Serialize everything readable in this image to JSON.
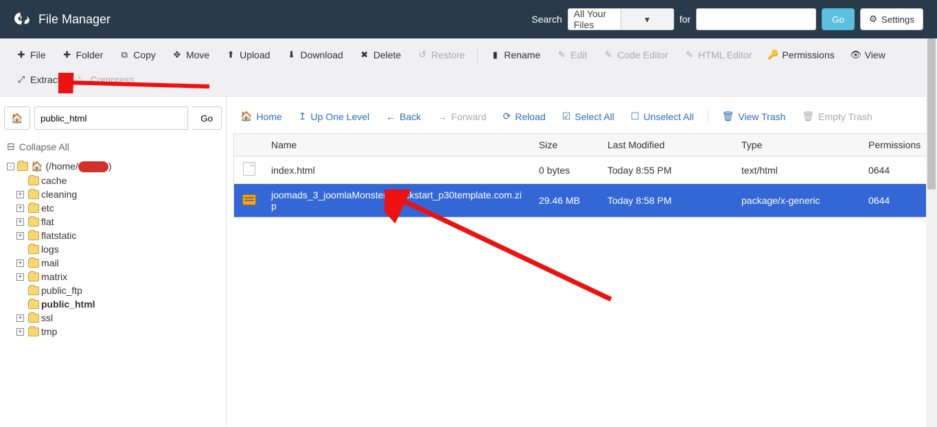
{
  "header": {
    "title": "File Manager",
    "search_label": "Search",
    "search_scope": "All Your Files",
    "for_label": "for",
    "search_value": "",
    "go_label": "Go",
    "settings_label": "Settings"
  },
  "toolbar": {
    "file": "File",
    "folder": "Folder",
    "copy": "Copy",
    "move": "Move",
    "upload": "Upload",
    "download": "Download",
    "delete": "Delete",
    "restore": "Restore",
    "rename": "Rename",
    "edit": "Edit",
    "code_editor": "Code Editor",
    "html_editor": "HTML Editor",
    "permissions": "Permissions",
    "view": "View",
    "extract": "Extract",
    "compress": "Compress"
  },
  "sidebar": {
    "path_value": "public_html",
    "go_label": "Go",
    "collapse_all": "Collapse All",
    "root_label_prefix": "(/home/",
    "root_label_suffix": ")",
    "folders": [
      {
        "name": "cache",
        "expandable": false
      },
      {
        "name": "cleaning",
        "expandable": true
      },
      {
        "name": "etc",
        "expandable": true
      },
      {
        "name": "flat",
        "expandable": true
      },
      {
        "name": "flatstatic",
        "expandable": true
      },
      {
        "name": "logs",
        "expandable": false
      },
      {
        "name": "mail",
        "expandable": true
      },
      {
        "name": "matrix",
        "expandable": true
      },
      {
        "name": "public_ftp",
        "expandable": false
      },
      {
        "name": "public_html",
        "expandable": false,
        "bold": true
      },
      {
        "name": "ssl",
        "expandable": true
      },
      {
        "name": "tmp",
        "expandable": true
      }
    ]
  },
  "actionbar": {
    "home": "Home",
    "up_one": "Up One Level",
    "back": "Back",
    "forward": "Forward",
    "reload": "Reload",
    "select_all": "Select All",
    "unselect_all": "Unselect All",
    "view_trash": "View Trash",
    "empty_trash": "Empty Trash"
  },
  "table": {
    "headers": {
      "name": "Name",
      "size": "Size",
      "last_modified": "Last Modified",
      "type": "Type",
      "permissions": "Permissions"
    },
    "rows": [
      {
        "icon": "html",
        "name": "index.html",
        "size": "0 bytes",
        "last_modified": "Today 8:55 PM",
        "type": "text/html",
        "permissions": "0644",
        "selected": false
      },
      {
        "icon": "zip",
        "name": "joomads_3_joomlaMonster_quickstart_p30template.com.zip",
        "size": "29.46 MB",
        "last_modified": "Today 8:58 PM",
        "type": "package/x-generic",
        "permissions": "0644",
        "selected": true
      }
    ]
  }
}
